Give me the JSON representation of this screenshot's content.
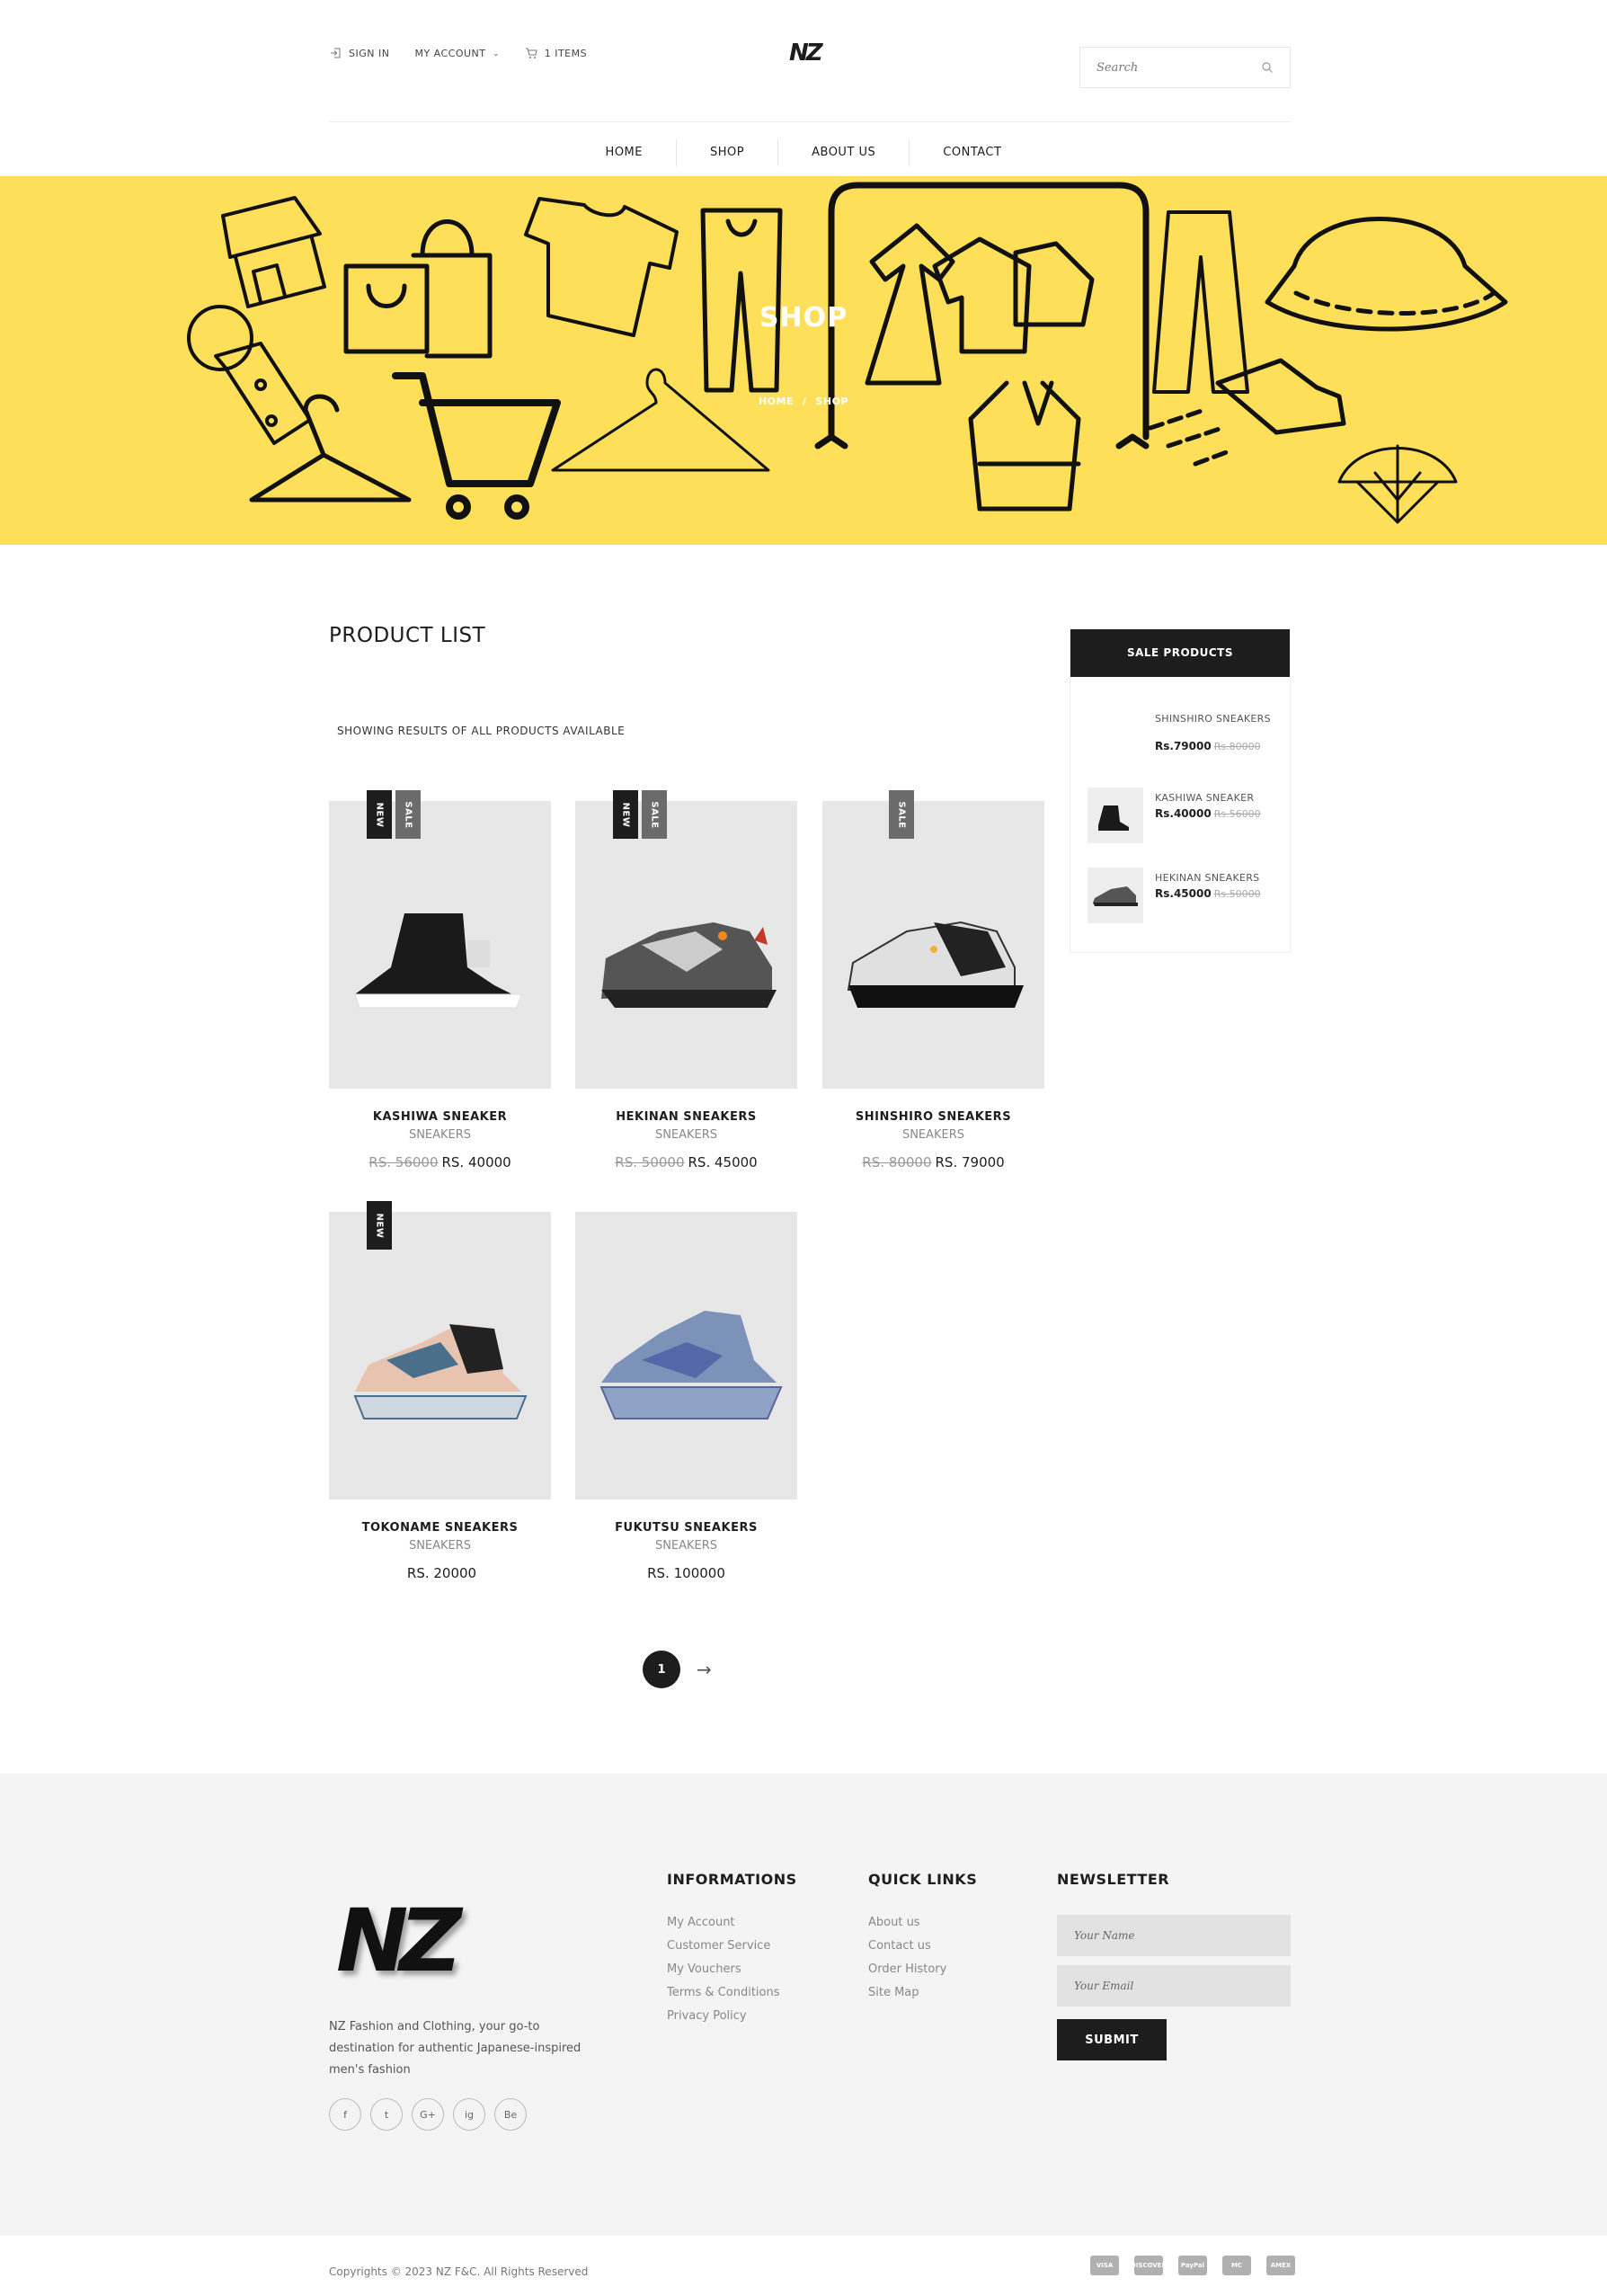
{
  "header": {
    "sign_in": "SIGN IN",
    "my_account": "MY ACCOUNT",
    "cart": "1 ITEMS",
    "logo": "NZ",
    "search_placeholder": "Search"
  },
  "nav": [
    "HOME",
    "SHOP",
    "ABOUT US",
    "CONTACT"
  ],
  "banner": {
    "title": "SHOP",
    "crumb_home": "HOME",
    "crumb_sep": "/",
    "crumb_current": "SHOP",
    "bg": "#fddf5a"
  },
  "product_list": {
    "title": "PRODUCT LIST",
    "showing": "SHOWING RESULTS OF ALL PRODUCTS AVAILABLE",
    "products": [
      {
        "name": "KASHIWA SNEAKER",
        "category": "SNEAKERS",
        "old_price": "RS. 56000",
        "price": "RS. 40000",
        "badges": [
          "NEW",
          "SALE"
        ]
      },
      {
        "name": "HEKINAN SNEAKERS",
        "category": "SNEAKERS",
        "old_price": "RS. 50000",
        "price": "RS. 45000",
        "badges": [
          "NEW",
          "SALE"
        ]
      },
      {
        "name": "SHINSHIRO SNEAKERS",
        "category": "SNEAKERS",
        "old_price": "RS. 80000",
        "price": "RS. 79000",
        "badges": [
          "SALE"
        ]
      },
      {
        "name": "TOKONAME SNEAKERS",
        "category": "SNEAKERS",
        "old_price": "",
        "price": "RS. 20000",
        "badges": [
          "NEW"
        ]
      },
      {
        "name": "FUKUTSU SNEAKERS",
        "category": "SNEAKERS",
        "old_price": "",
        "price": "RS. 100000",
        "badges": []
      }
    ],
    "page": "1",
    "next_arrow": "→"
  },
  "sidebar": {
    "title": "SALE PRODUCTS",
    "items": [
      {
        "name": "SHINSHIRO SNEAKERS",
        "price": "Rs.79000",
        "old": "Rs.80000"
      },
      {
        "name": "KASHIWA SNEAKER",
        "price": "Rs.40000",
        "old": "Rs.56000"
      },
      {
        "name": "HEKINAN SNEAKERS",
        "price": "Rs.45000",
        "old": "Rs.50000"
      }
    ]
  },
  "footer": {
    "logo": "NZ",
    "description": "NZ Fashion and Clothing, your go-to destination for authentic Japanese-inspired men's fashion",
    "social": [
      "f",
      "t",
      "G+",
      "ig",
      "Be"
    ],
    "informations": {
      "title": "INFORMATIONS",
      "links": [
        "My Account",
        "Customer Service",
        "My Vouchers",
        "Terms & Conditions",
        "Privacy Policy"
      ]
    },
    "quick_links": {
      "title": "QUICK LINKS",
      "links": [
        "About us",
        "Contact us",
        "Order History",
        "Site Map"
      ]
    },
    "newsletter": {
      "title": "NEWSLETTER",
      "name_placeholder": "Your Name",
      "email_placeholder": "Your Email",
      "submit": "SUBMIT"
    },
    "copyright": "Copyrights © 2023 NZ F&C. All Rights Reserved",
    "payments": [
      "VISA",
      "DISCOVER",
      "PayPal",
      "MC",
      "AMEX"
    ]
  }
}
